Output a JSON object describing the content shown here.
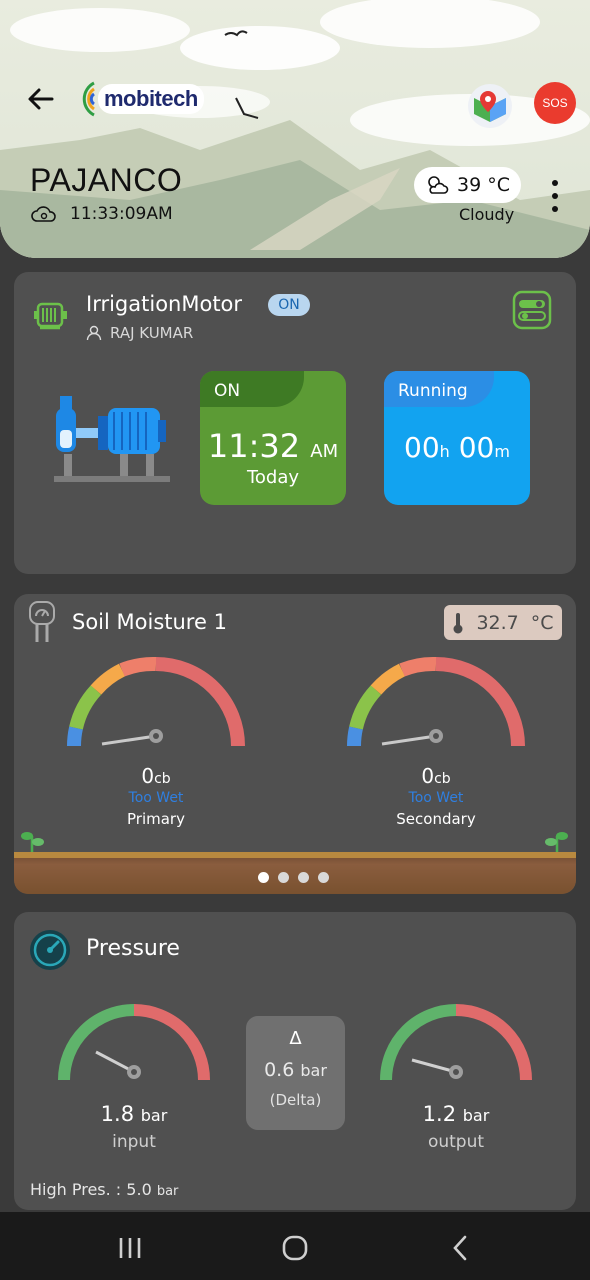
{
  "header": {
    "logo_text": "mobitech",
    "sos_label": "SOS",
    "site_name": "PAJANCO",
    "time": "11:33:09AM",
    "temperature": "39 °C",
    "weather": "Cloudy",
    "icons": [
      "back-arrow-icon",
      "map-icon",
      "cloud-icon",
      "partly-cloudy-icon",
      "more-vert-icon"
    ]
  },
  "motor": {
    "name": "IrrigationMotor",
    "status_badge": "ON",
    "user": "RAJ KUMAR",
    "on_label": "ON",
    "on_time": "11:32",
    "on_ampm": "AM",
    "on_day": "Today",
    "running_label": "Running",
    "running_h": "00",
    "running_h_unit": "h",
    "running_m": "00",
    "running_m_unit": "m"
  },
  "soil": {
    "title": "Soil Moisture 1",
    "temperature": "32.7",
    "temperature_unit": "°C",
    "gauges": [
      {
        "value": "0",
        "unit": "cb",
        "status": "Too Wet",
        "label": "Primary",
        "level": 0
      },
      {
        "value": "0",
        "unit": "cb",
        "status": "Too Wet",
        "label": "Secondary",
        "level": 0
      }
    ],
    "page_count": 4,
    "page_active": 1
  },
  "pressure": {
    "title": "Pressure",
    "input_value": "1.8",
    "input_unit": "bar",
    "input_label": "input",
    "output_value": "1.2",
    "output_unit": "bar",
    "output_label": "output",
    "delta_symbol": "Δ",
    "delta_value": "0.6",
    "delta_unit": "bar",
    "delta_label": "(Delta)",
    "high_label": "High Pres. :",
    "high_value": "5.0",
    "high_unit": "bar"
  },
  "colors": {
    "card": "#505050",
    "on_green": "#5c9b35",
    "running_blue": "#12a3f0",
    "too_wet_blue": "#2f7fe0",
    "gauge_red": "#e06b6b",
    "gauge_green": "#5fb36b"
  }
}
